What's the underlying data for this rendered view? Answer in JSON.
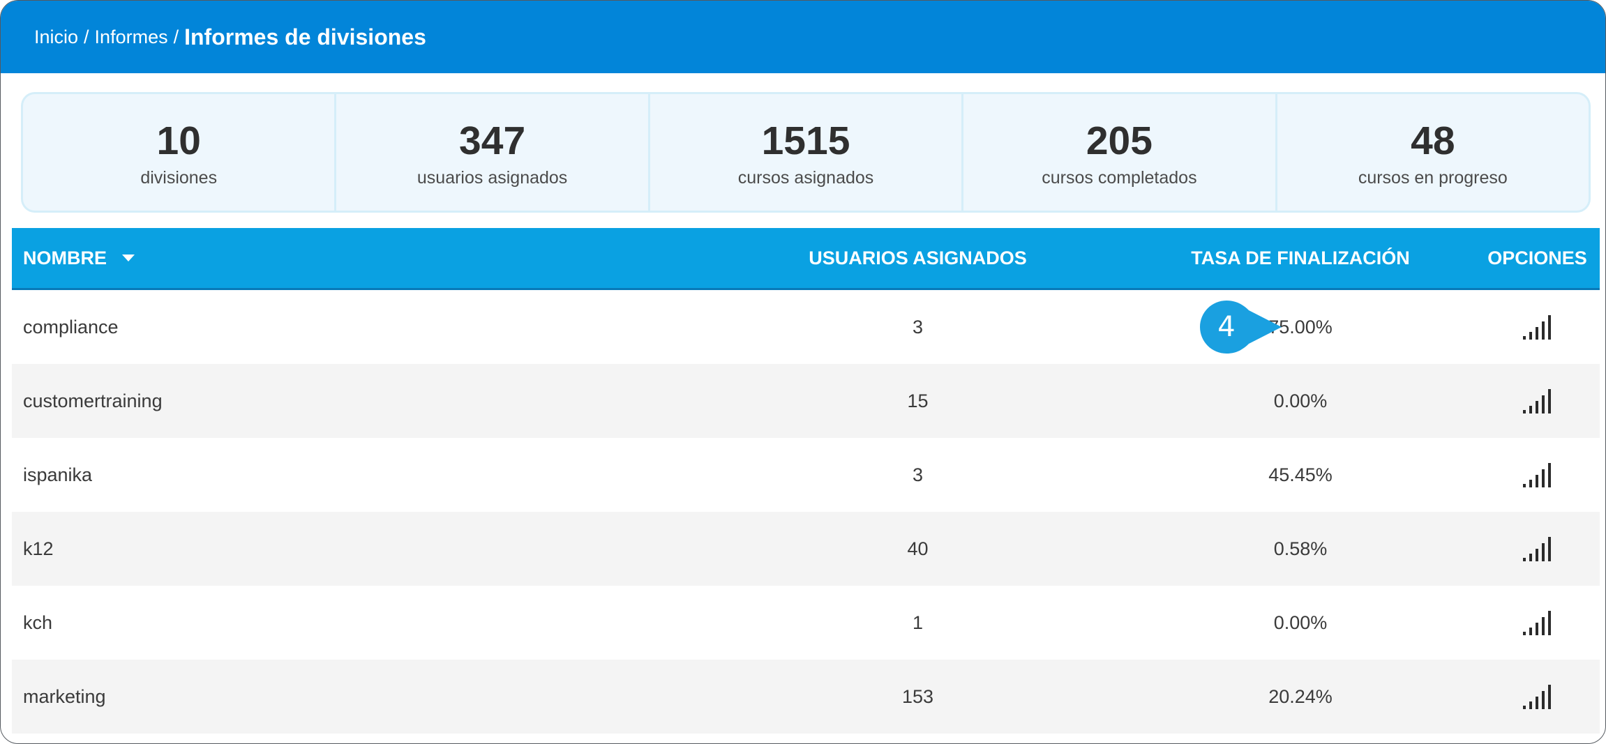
{
  "breadcrumb": {
    "home": "Inicio",
    "reports": "Informes",
    "separator": "/",
    "current": "Informes de divisiones"
  },
  "stats": [
    {
      "value": "10",
      "label": "divisiones"
    },
    {
      "value": "347",
      "label": "usuarios asignados"
    },
    {
      "value": "1515",
      "label": "cursos asignados"
    },
    {
      "value": "205",
      "label": "cursos completados"
    },
    {
      "value": "48",
      "label": "cursos en progreso"
    }
  ],
  "table": {
    "headers": {
      "name": "NOMBRE",
      "users": "USUARIOS ASIGNADOS",
      "rate": "TASA DE FINALIZACIÓN",
      "options": "OPCIONES"
    },
    "rows": [
      {
        "name": "compliance",
        "users": "3",
        "rate": "75.00%"
      },
      {
        "name": "customertraining",
        "users": "15",
        "rate": "0.00%"
      },
      {
        "name": "ispanika",
        "users": "3",
        "rate": "45.45%"
      },
      {
        "name": "k12",
        "users": "40",
        "rate": "0.58%"
      },
      {
        "name": "kch",
        "users": "1",
        "rate": "0.00%"
      },
      {
        "name": "marketing",
        "users": "153",
        "rate": "20.24%"
      }
    ]
  },
  "callout": {
    "number": "4"
  },
  "icons": {
    "sort": "caret-down-icon",
    "options": "bar-chart-icon"
  },
  "colors": {
    "topbar": "#0285d9",
    "table_header": "#0aa1e2",
    "callout": "#1aa0e0"
  }
}
